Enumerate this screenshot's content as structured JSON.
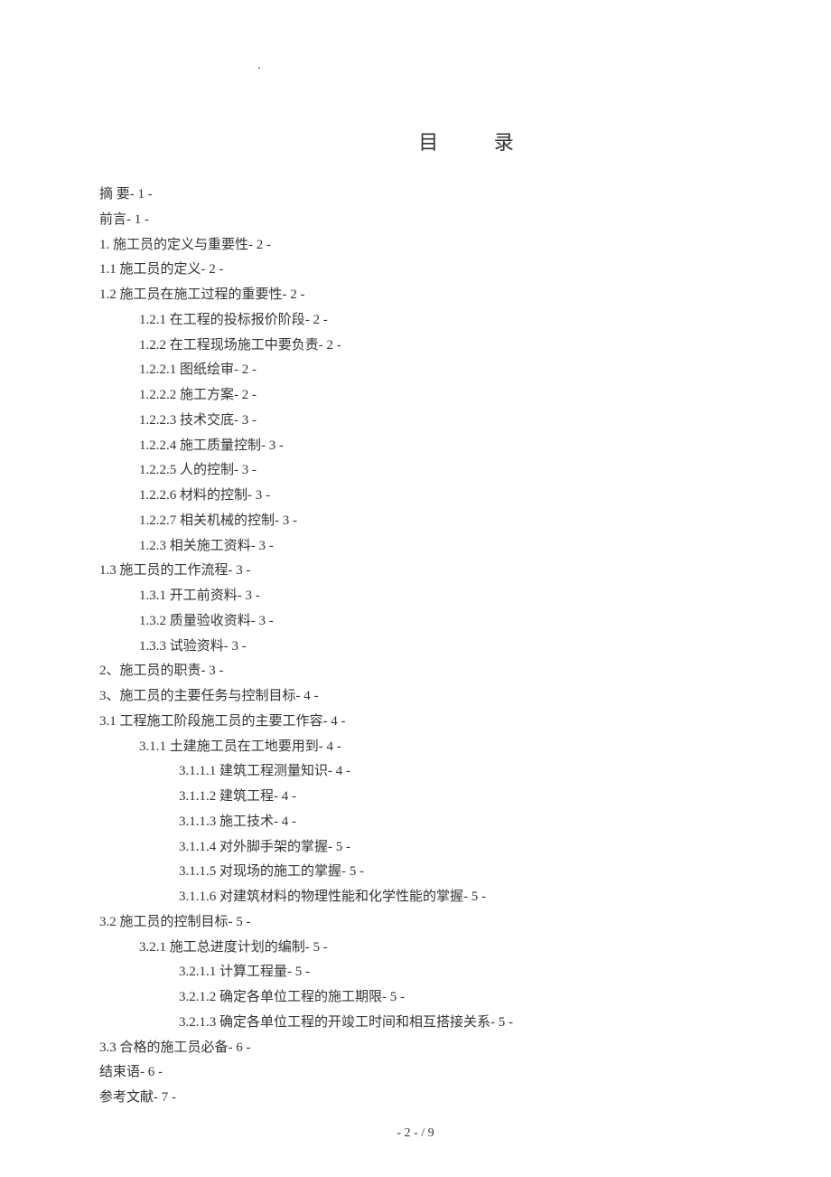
{
  "dot": ".",
  "title": "目 录",
  "toc": [
    {
      "level": 0,
      "text": "摘 要- 1 -"
    },
    {
      "level": 0,
      "text": "前言- 1 -"
    },
    {
      "level": 0,
      "text": "1. 施工员的定义与重要性- 2 -"
    },
    {
      "level": 0,
      "text": "1.1 施工员的定义- 2 -"
    },
    {
      "level": 0,
      "text": "1.2 施工员在施工过程的重要性- 2 -"
    },
    {
      "level": 1,
      "text": "1.2.1 在工程的投标报价阶段- 2 -"
    },
    {
      "level": 1,
      "text": "1.2.2 在工程现场施工中要负责- 2 -"
    },
    {
      "level": 1,
      "text": "1.2.2.1 图纸绘审- 2 -"
    },
    {
      "level": 1,
      "text": "1.2.2.2 施工方案- 2 -"
    },
    {
      "level": 1,
      "text": "1.2.2.3 技术交底- 3 -"
    },
    {
      "level": 1,
      "text": "1.2.2.4 施工质量控制- 3 -"
    },
    {
      "level": 1,
      "text": "1.2.2.5 人的控制- 3 -"
    },
    {
      "level": 1,
      "text": "1.2.2.6 材料的控制- 3 -"
    },
    {
      "level": 1,
      "text": "1.2.2.7 相关机械的控制- 3 -"
    },
    {
      "level": 1,
      "text": "1.2.3 相关施工资料- 3 -"
    },
    {
      "level": 0,
      "text": "1.3 施工员的工作流程- 3 -"
    },
    {
      "level": 1,
      "text": "1.3.1 开工前资料- 3 -"
    },
    {
      "level": 1,
      "text": "1.3.2 质量验收资料- 3 -"
    },
    {
      "level": 1,
      "text": "1.3.3 试验资料- 3 -"
    },
    {
      "level": 0,
      "text": "2、施工员的职责- 3 -"
    },
    {
      "level": 0,
      "text": "3、施工员的主要任务与控制目标- 4 -"
    },
    {
      "level": 0,
      "text": "3.1 工程施工阶段施工员的主要工作容- 4 -"
    },
    {
      "level": 1,
      "text": "3.1.1 土建施工员在工地要用到- 4 -"
    },
    {
      "level": 2,
      "text": "3.1.1.1 建筑工程测量知识- 4 -"
    },
    {
      "level": 2,
      "text": "3.1.1.2 建筑工程- 4 -"
    },
    {
      "level": 2,
      "text": "3.1.1.3 施工技术- 4 -"
    },
    {
      "level": 2,
      "text": "3.1.1.4 对外脚手架的掌握- 5 -"
    },
    {
      "level": 2,
      "text": "3.1.1.5 对现场的施工的掌握- 5 -"
    },
    {
      "level": 2,
      "text": "3.1.1.6 对建筑材料的物理性能和化学性能的掌握- 5 -"
    },
    {
      "level": 0,
      "text": "3.2 施工员的控制目标- 5 -"
    },
    {
      "level": 1,
      "text": "3.2.1 施工总进度计划的编制- 5 -"
    },
    {
      "level": 2,
      "text": "3.2.1.1 计算工程量- 5 -"
    },
    {
      "level": 2,
      "text": "3.2.1.2 确定各单位工程的施工期限- 5 -"
    },
    {
      "level": 2,
      "text": "3.2.1.3 确定各单位工程的开竣工时间和相互搭接关系- 5 -"
    },
    {
      "level": 0,
      "text": "3.3 合格的施工员必备- 6 -"
    },
    {
      "level": 0,
      "text": "结束语- 6 -"
    },
    {
      "level": 0,
      "text": "参考文献- 7 -"
    }
  ],
  "footer": "- 2 -  / 9"
}
